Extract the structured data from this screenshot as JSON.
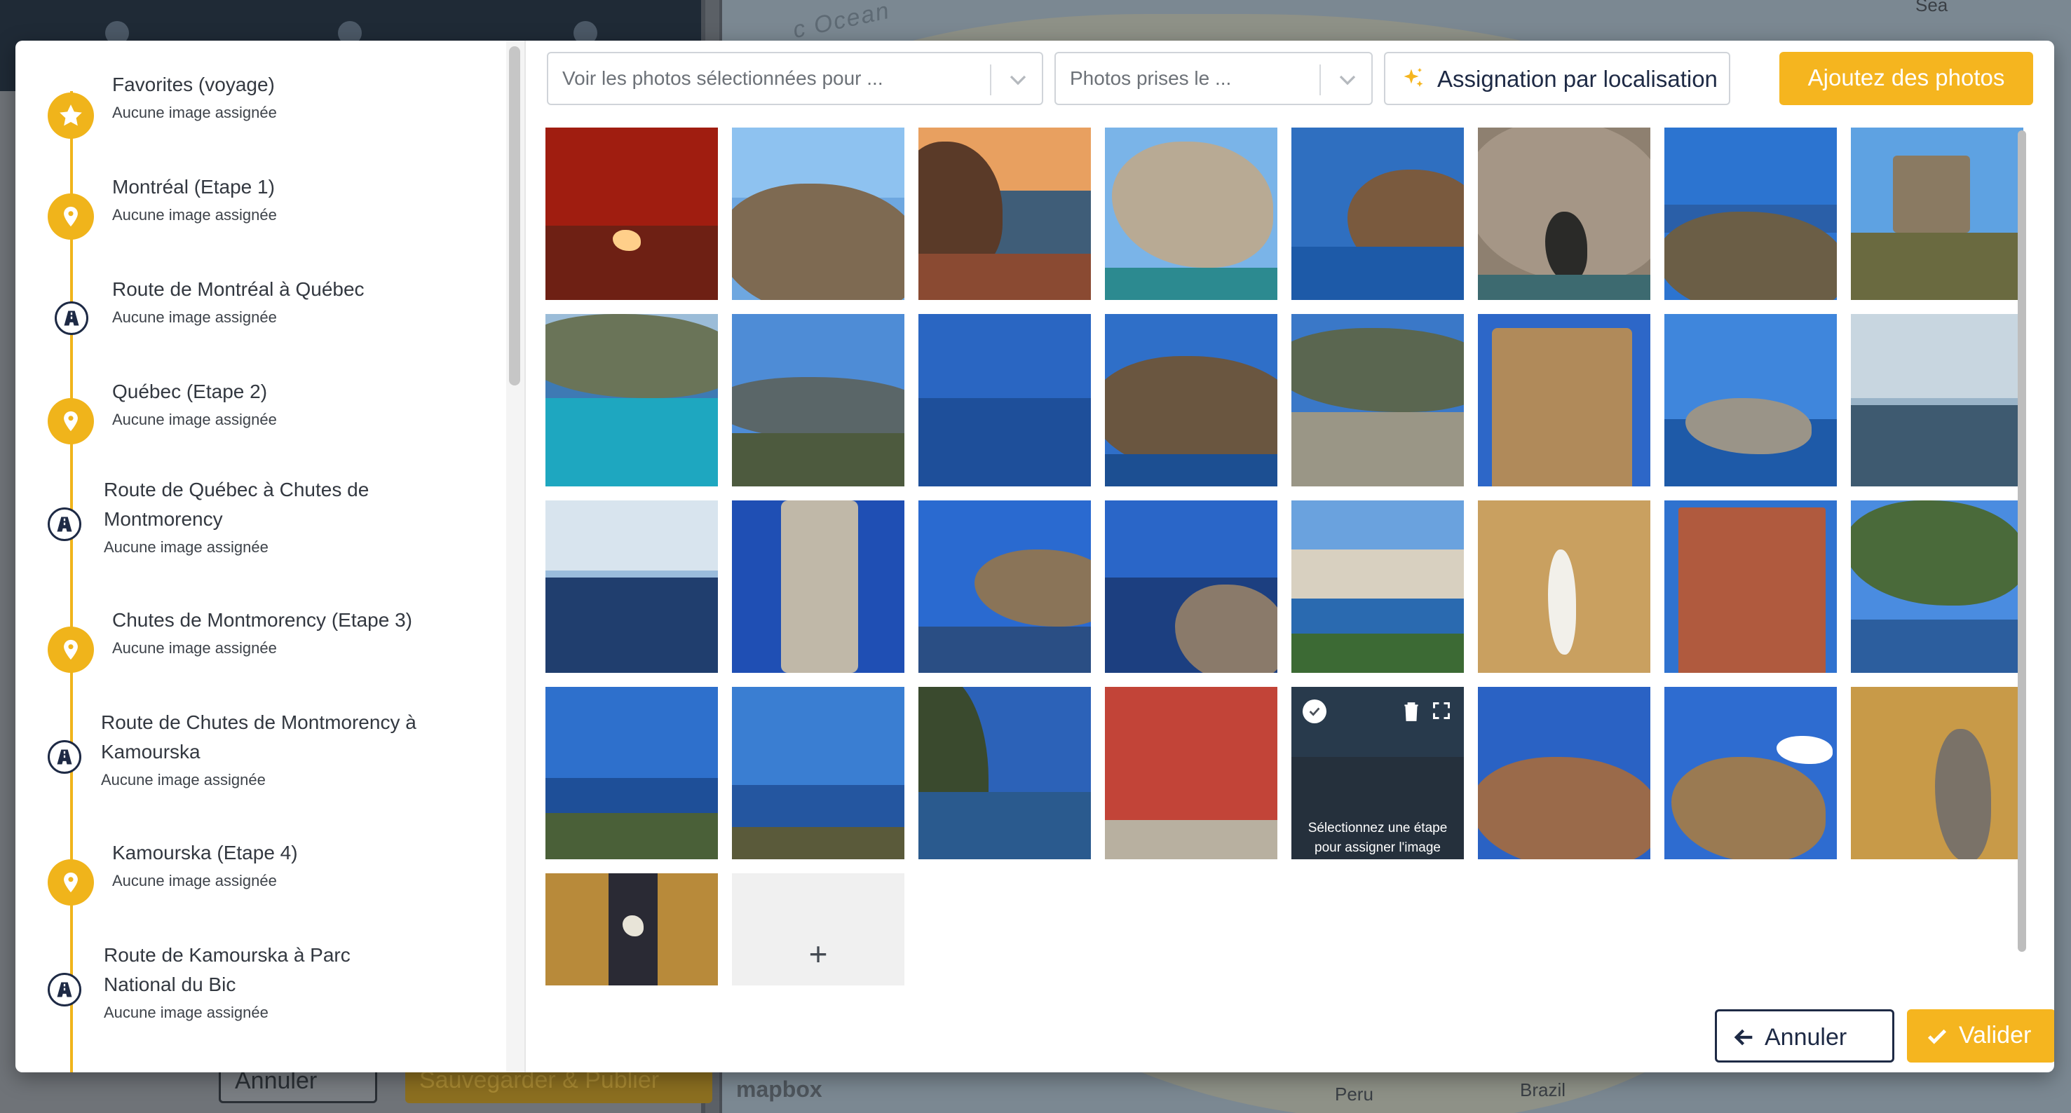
{
  "background": {
    "map_label_ocean": "c Ocean",
    "map_label_sea": "Sea",
    "map_label_peru": "Peru",
    "map_label_brazil": "Brazil",
    "mapbox": "mapbox",
    "cancel_label": "Annuler",
    "save_label": "Sauvegarder & Publier"
  },
  "sidebar": {
    "items": [
      {
        "icon": "star-icon",
        "title": "Favorites (voyage)",
        "subtitle": "Aucune image assignée",
        "type": "favorites"
      },
      {
        "icon": "location-pin-icon",
        "title": "Montréal (Etape 1)",
        "subtitle": "Aucune image assignée",
        "type": "step"
      },
      {
        "icon": "road-icon",
        "title": "Route de Montréal à Québec",
        "subtitle": "Aucune image assignée",
        "type": "route"
      },
      {
        "icon": "location-pin-icon",
        "title": "Québec (Etape 2)",
        "subtitle": "Aucune image assignée",
        "type": "step"
      },
      {
        "icon": "road-icon",
        "title_line1": "Route de Québec à Chutes de",
        "title_line2": "Montmorency",
        "subtitle": "Aucune image assignée",
        "type": "route"
      },
      {
        "icon": "location-pin-icon",
        "title": "Chutes de Montmorency (Etape 3)",
        "subtitle": "Aucune image assignée",
        "type": "step"
      },
      {
        "icon": "road-icon",
        "title_line1": "Route de Chutes de Montmorency à",
        "title_line2": "Kamourska",
        "subtitle": "Aucune image assignée",
        "type": "route"
      },
      {
        "icon": "location-pin-icon",
        "title": "Kamourska (Etape 4)",
        "subtitle": "Aucune image assignée",
        "type": "step"
      },
      {
        "icon": "road-icon",
        "title_line1": "Route de Kamourska à Parc",
        "title_line2": "National du Bic",
        "subtitle": "Aucune image assignée",
        "type": "route"
      }
    ]
  },
  "toolbar": {
    "filter_step_placeholder": "Voir les photos sélectionnées pour ...",
    "filter_date_placeholder": "Photos prises le ...",
    "assign_location_label": "Assignation par localisation",
    "add_photos_label": "Ajoutez des photos"
  },
  "photos": {
    "count": 33,
    "hover_overlay_text_line1": "Sélectionnez une étape",
    "hover_overlay_text_line2": "pour assigner l'image",
    "add_tile_symbol": "+"
  },
  "footer": {
    "cancel_label": "Annuler",
    "validate_label": "Valider"
  },
  "colors": {
    "accent": "#f5b51f",
    "timeline": "#f0b41b",
    "navy": "#1e2a45"
  }
}
